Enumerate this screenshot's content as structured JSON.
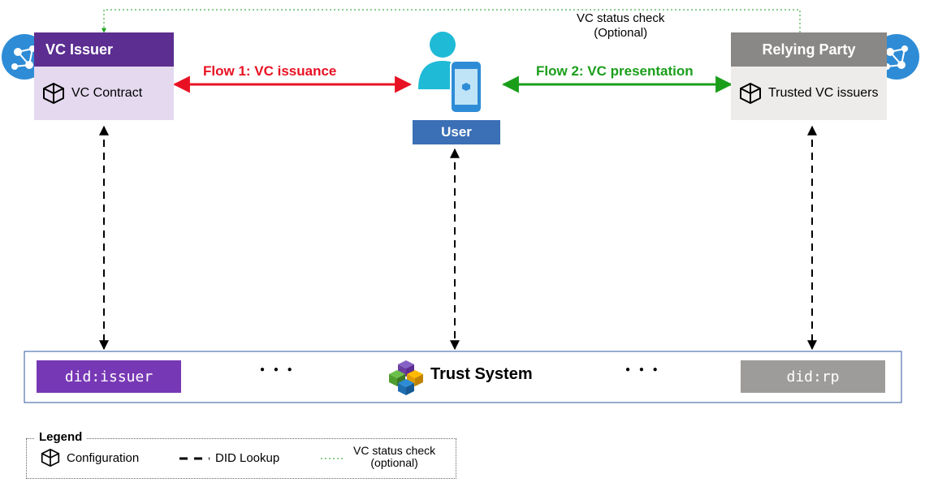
{
  "issuer": {
    "title": "VC Issuer",
    "body": "VC Contract",
    "did": "did:issuer"
  },
  "user": {
    "label": "User"
  },
  "rp": {
    "title": "Relying Party",
    "body": "Trusted VC issuers",
    "did": "did:rp"
  },
  "flows": {
    "f1": "Flow 1: VC  issuance",
    "f2": "Flow 2: VC presentation"
  },
  "status_check": {
    "line1": "VC status check",
    "line2": "(Optional)"
  },
  "trust": {
    "title": "Trust System"
  },
  "ellipsis": "● ● ●",
  "legend": {
    "title": "Legend",
    "config": "Configuration",
    "did_lookup": "DID Lookup",
    "status": "VC status check",
    "status2": "(optional)"
  },
  "colors": {
    "purple_dark": "#5c2e91",
    "purple_light": "#e4d9ef",
    "gray_dark": "#8a8886",
    "gray_light": "#e8e6e5",
    "blue_user": "#3b6fb6",
    "cyan": "#1fbad6",
    "red": "#e81123",
    "green": "#107c10",
    "did_purple": "#7738b5",
    "did_gray": "#9e9c9a"
  }
}
